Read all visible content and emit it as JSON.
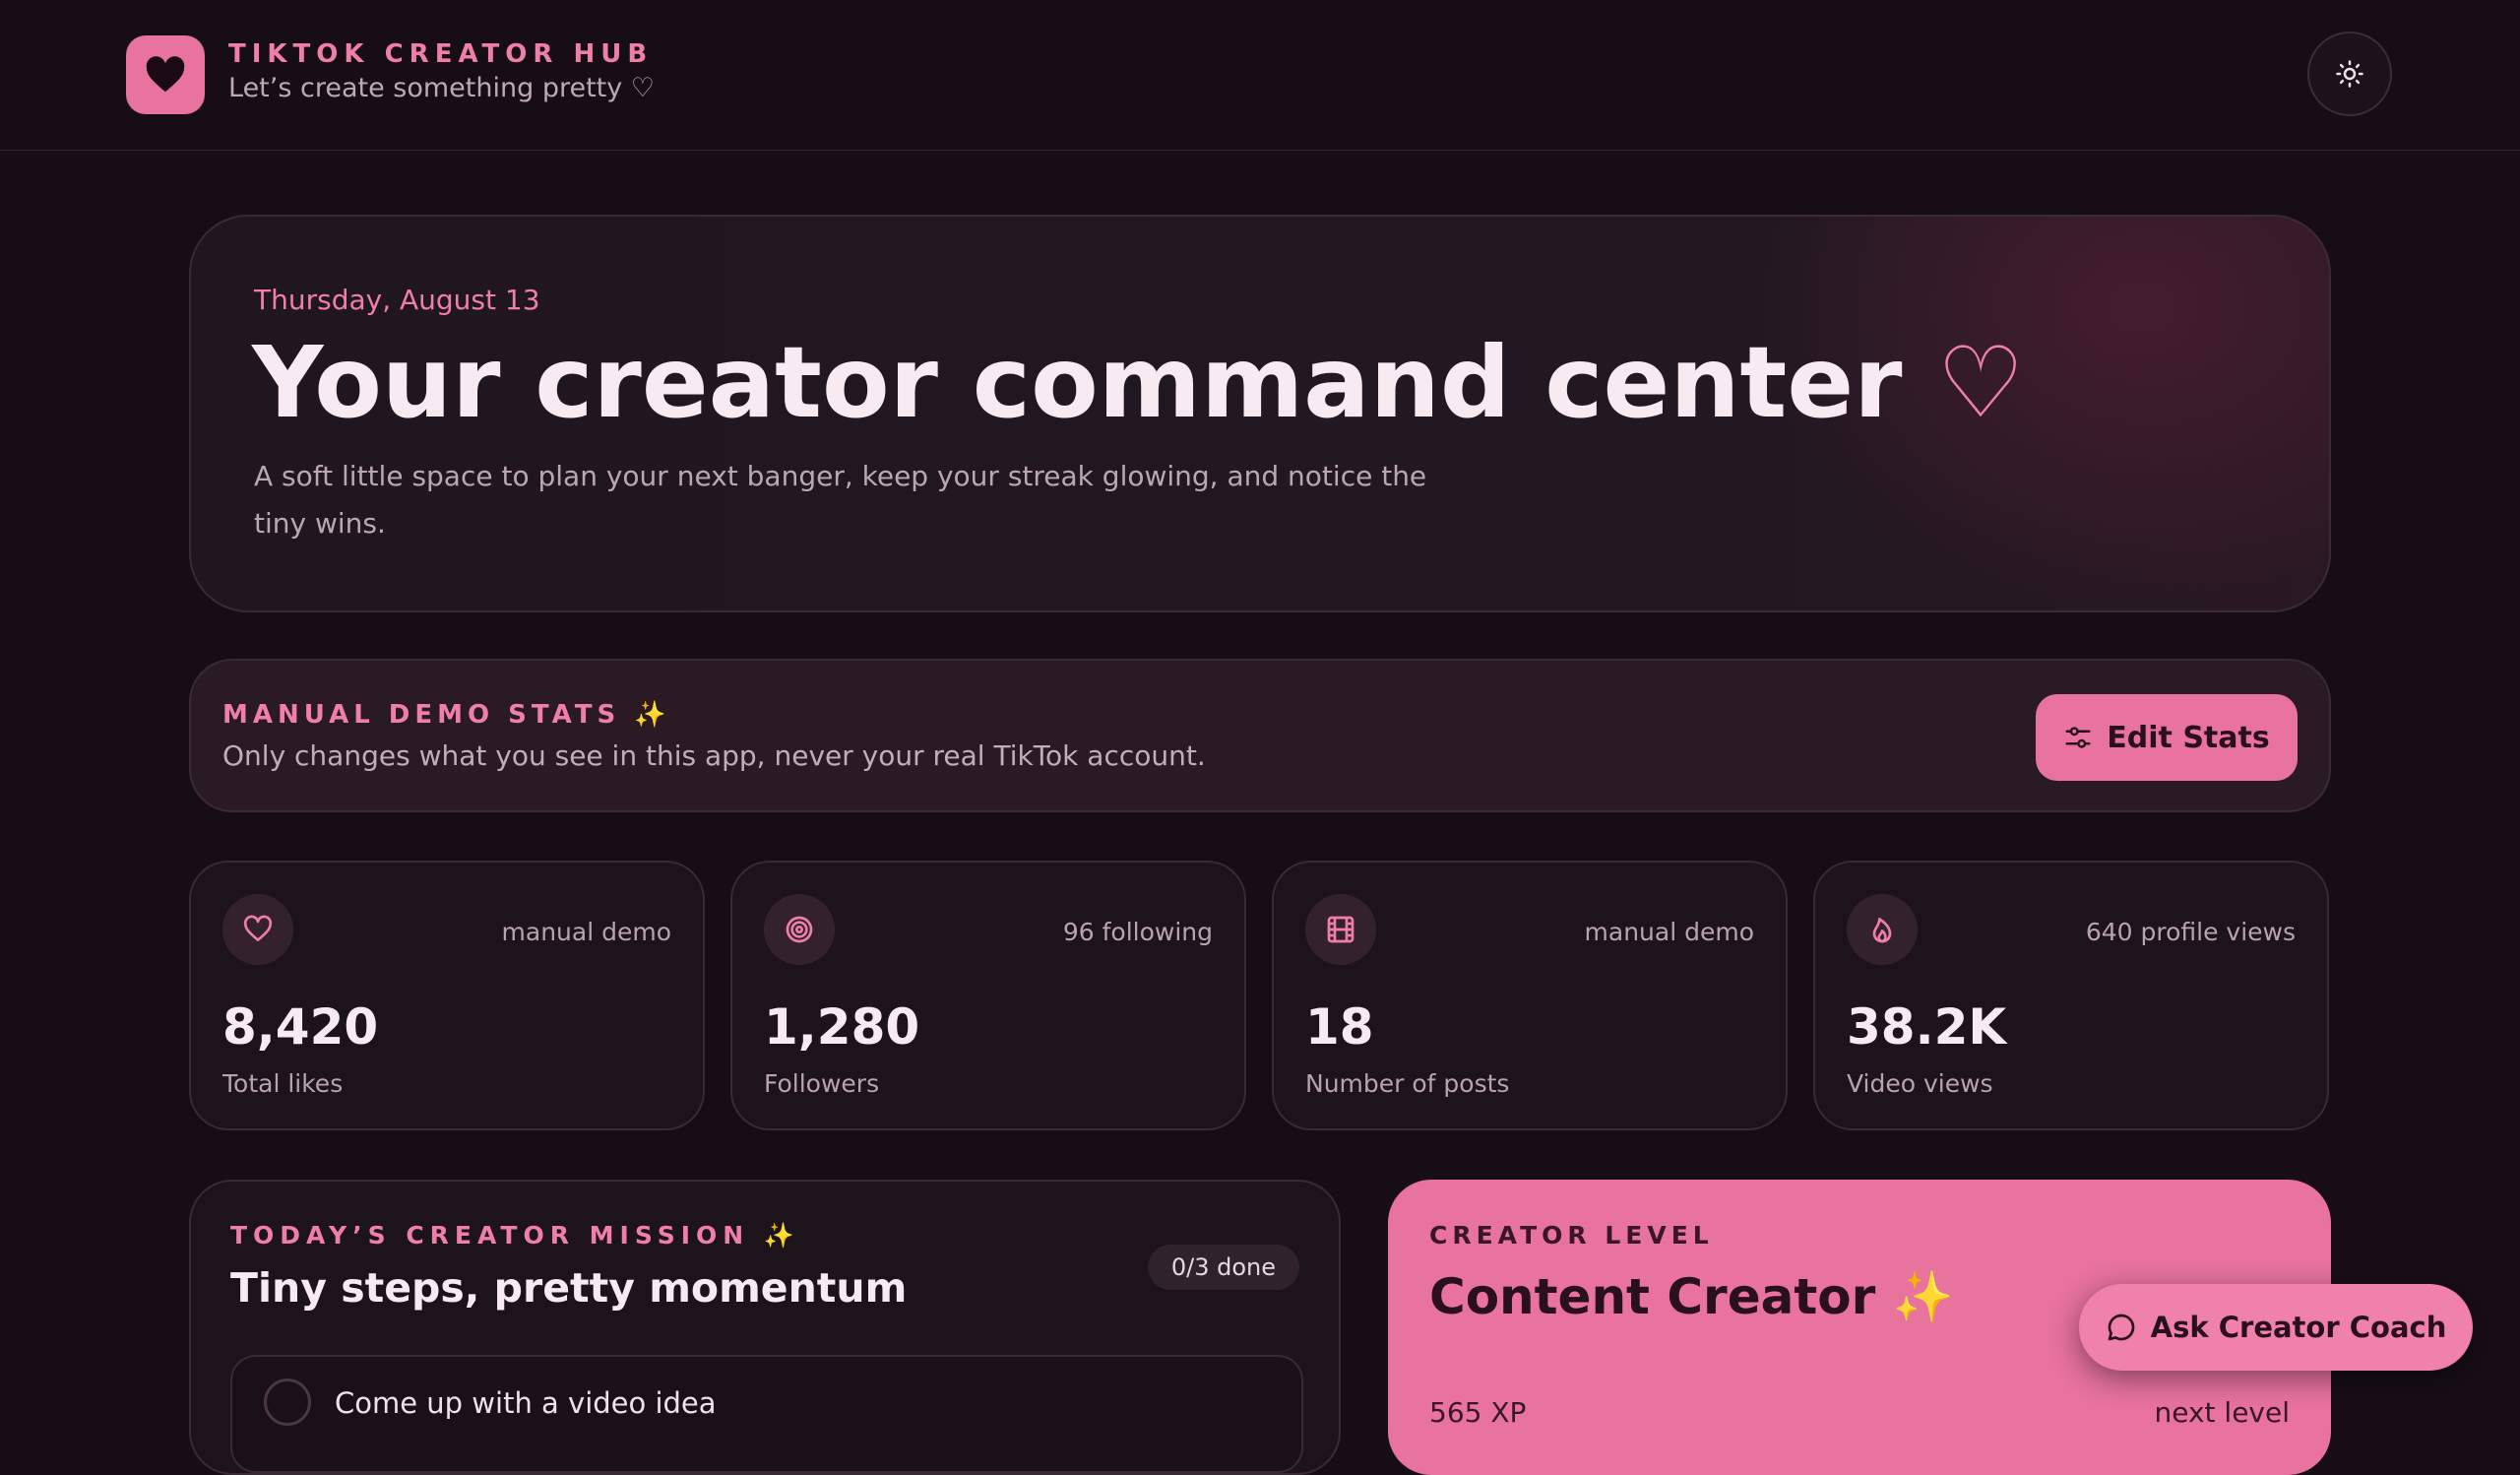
{
  "app": {
    "title": "TIKTOK CREATOR HUB",
    "subtitle": "Let’s create something pretty ♡",
    "theme_toggle_icon": "sun-icon"
  },
  "hero": {
    "date": "Thursday, August 13",
    "title": "Your creator command center",
    "title_heart": "♡",
    "description": "A soft little space to plan your next banger, keep your streak glowing, and notice the tiny wins."
  },
  "manual_stats": {
    "title": "MANUAL DEMO STATS ✨",
    "description": "Only changes what you see in this app, never your real TikTok account.",
    "edit_label": "Edit Stats"
  },
  "stats": [
    {
      "icon": "heart-icon",
      "meta": "manual demo",
      "value": "8,420",
      "label": "Total likes"
    },
    {
      "icon": "target-icon",
      "meta": "96 following",
      "value": "1,280",
      "label": "Followers"
    },
    {
      "icon": "film-icon",
      "meta": "manual demo",
      "value": "18",
      "label": "Number of posts"
    },
    {
      "icon": "flame-icon",
      "meta": "640 profile views",
      "value": "38.2K",
      "label": "Video views"
    }
  ],
  "mission": {
    "kicker": "TODAY’S CREATOR MISSION ✨",
    "title": "Tiny steps, pretty momentum",
    "badge": "0/3 done",
    "tasks": [
      {
        "label": "Come up with a video idea",
        "done": false
      }
    ]
  },
  "level": {
    "kicker": "CREATOR LEVEL",
    "title": "Content Creator ✨",
    "xp": "565 XP",
    "next": "next level"
  },
  "coach": {
    "label": "Ask Creator Coach"
  },
  "colors": {
    "background": "#170e14",
    "accent": "#e8739d",
    "accent_text": "#ef7fa7"
  }
}
